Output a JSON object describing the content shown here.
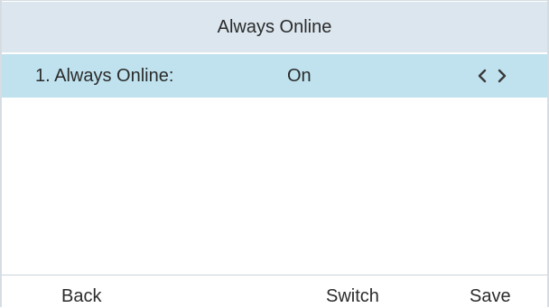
{
  "screen": {
    "title": "Always Online"
  },
  "menu": {
    "items": [
      {
        "label": "1. Always Online:",
        "value": "On",
        "left_icon": "chevron-left-icon",
        "right_icon": "chevron-right-icon"
      }
    ],
    "selected_color": "#bfe2ee"
  },
  "softkeys": {
    "back": "Back",
    "switch": "Switch",
    "save": "Save"
  },
  "colors": {
    "title_bar": "#dbe6ee",
    "text": "#2b2b2b",
    "background": "#ffffff"
  }
}
